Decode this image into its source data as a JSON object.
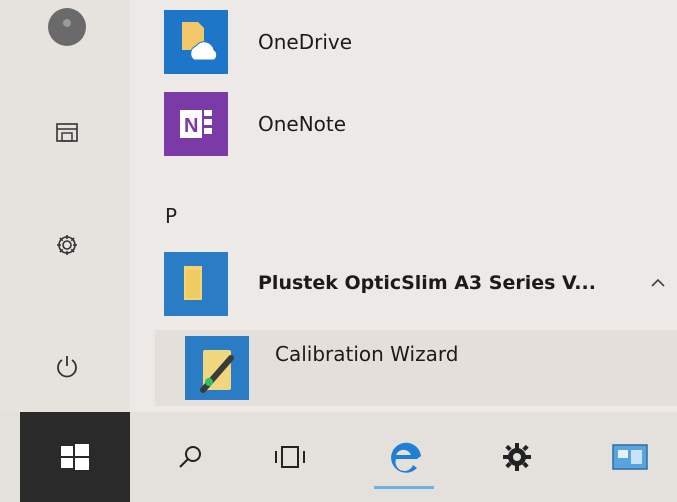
{
  "start_menu": {
    "letter_header_p": "P",
    "apps": [
      {
        "label": "OneDrive"
      },
      {
        "label": "OneNote"
      },
      {
        "label": "Plustek OpticSlim A3 Series V...",
        "expand_icon": "chevron-up-icon"
      },
      {
        "label": "Calibration Wizard"
      }
    ]
  },
  "rail": {
    "items": [
      "user-avatar",
      "documents-icon",
      "settings-icon",
      "power-icon"
    ]
  },
  "taskbar": {
    "items": [
      "windows-logo-icon",
      "search-icon",
      "task-view-icon",
      "edge-icon",
      "settings-gear-icon",
      "app-thumbnail-icon"
    ]
  },
  "colors": {
    "onedrive_tile": "#1e76c8",
    "onenote_tile": "#7b3aa6",
    "plustek_tile": "#2a7dc5",
    "edge_blue": "#1f7fd4",
    "start_button_bg": "#2a2a2a"
  }
}
